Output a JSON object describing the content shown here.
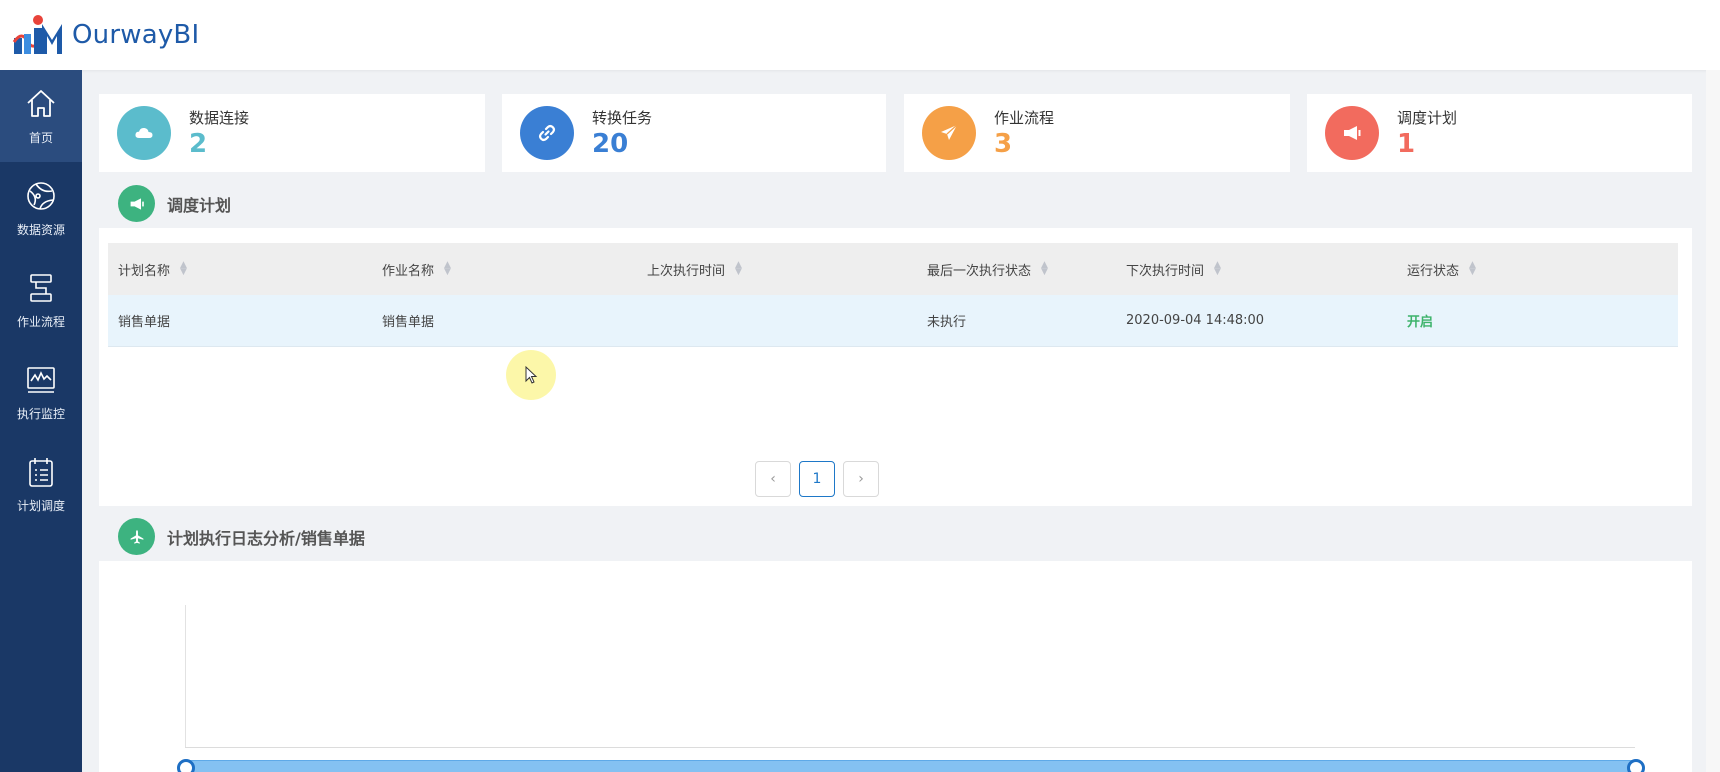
{
  "app": {
    "title": "OurwayBI"
  },
  "sidebar": {
    "items": [
      {
        "label": "首页",
        "icon": "home-icon",
        "active": true
      },
      {
        "label": "数据资源",
        "icon": "globe-icon",
        "active": false
      },
      {
        "label": "作业流程",
        "icon": "flow-icon",
        "active": false
      },
      {
        "label": "执行监控",
        "icon": "monitor-icon",
        "active": false
      },
      {
        "label": "计划调度",
        "icon": "checklist-icon",
        "active": false
      }
    ]
  },
  "stats": [
    {
      "label": "数据连接",
      "value": "2",
      "icon": "cloud-icon",
      "color": "#5bbccc"
    },
    {
      "label": "转换任务",
      "value": "20",
      "icon": "link-icon",
      "color": "#3a7fd4"
    },
    {
      "label": "作业流程",
      "value": "3",
      "icon": "paper-plane-icon",
      "color": "#f5a047"
    },
    {
      "label": "调度计划",
      "value": "1",
      "icon": "megaphone-icon",
      "color": "#f26b5e"
    }
  ],
  "schedule_section": {
    "title": "调度计划",
    "icon": "megaphone-icon",
    "columns": [
      "计划名称",
      "作业名称",
      "上次执行时间",
      "最后一次执行状态",
      "下次执行时间",
      "运行状态"
    ],
    "rows": [
      {
        "plan_name": "销售单据",
        "job_name": "销售单据",
        "last_run": "",
        "last_status": "未执行",
        "next_run": "2020-09-04 14:48:00",
        "run_status": "开启"
      }
    ],
    "pagination": {
      "prev": "‹",
      "current": "1",
      "next": "›"
    }
  },
  "log_section": {
    "title": "计划执行日志分析/销售单据",
    "icon": "airplane-icon"
  },
  "colors": {
    "sidebar": "#1a3866",
    "section_icon": "#3db380",
    "status_on": "#3db36b"
  }
}
